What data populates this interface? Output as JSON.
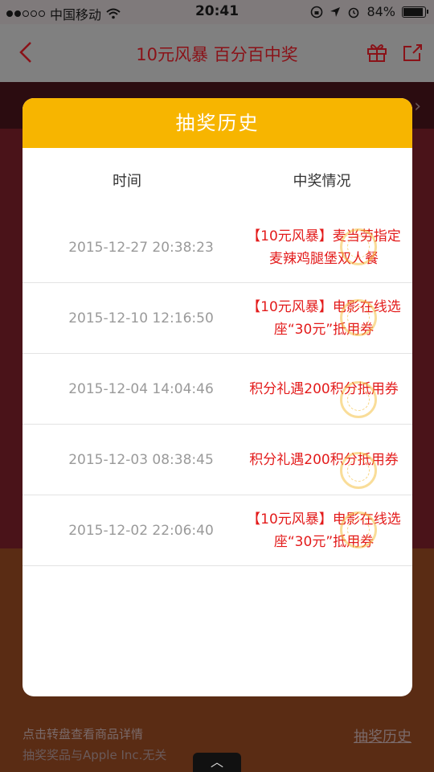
{
  "status_bar": {
    "carrier": "中国移动",
    "time": "20:41",
    "battery": "84%"
  },
  "nav": {
    "title": "10元风暴 百分百中奖"
  },
  "background": {
    "footer_hint": "点击转盘查看商品详情",
    "footer_disclaimer": "抽奖奖品与Apple Inc.无关",
    "history_link": "抽奖历史"
  },
  "modal": {
    "title": "抽奖历史",
    "col_time": "时间",
    "col_prize": "中奖情况",
    "records": [
      {
        "time": "2015-12-27 20:38:23",
        "prize": "【10元风暴】麦当劳指定麦辣鸡腿堡双人餐"
      },
      {
        "time": "2015-12-10 12:16:50",
        "prize": "【10元风暴】电影在线选座“30元”抵用券"
      },
      {
        "time": "2015-12-04 14:04:46",
        "prize": "积分礼遇200积分抵用券"
      },
      {
        "time": "2015-12-03 08:38:45",
        "prize": "积分礼遇200积分抵用券"
      },
      {
        "time": "2015-12-02 22:06:40",
        "prize": "【10元风暴】电影在线选座“30元”抵用券"
      }
    ]
  }
}
